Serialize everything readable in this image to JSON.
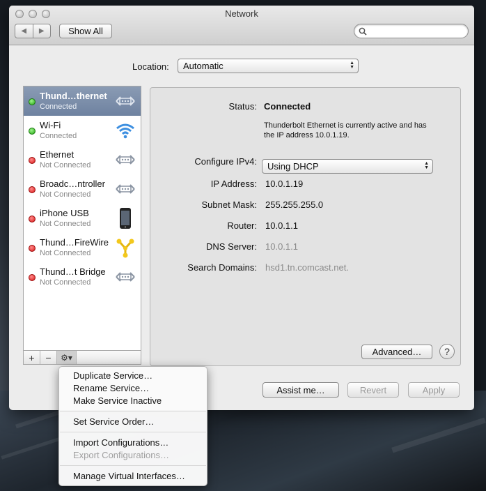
{
  "window": {
    "title": "Network"
  },
  "toolbar": {
    "back_icon": "chevron-left-icon",
    "forward_icon": "chevron-right-icon",
    "show_all_label": "Show All",
    "search_placeholder": ""
  },
  "location": {
    "label": "Location:",
    "value": "Automatic"
  },
  "services": [
    {
      "name": "Thund…thernet",
      "status": "Connected",
      "state": "green",
      "icon": "ethernet-icon",
      "selected": true
    },
    {
      "name": "Wi-Fi",
      "status": "Connected",
      "state": "green",
      "icon": "wifi-icon"
    },
    {
      "name": "Ethernet",
      "status": "Not Connected",
      "state": "red",
      "icon": "ethernet-icon"
    },
    {
      "name": "Broadc…ntroller",
      "status": "Not Connected",
      "state": "red",
      "icon": "ethernet-icon"
    },
    {
      "name": "iPhone USB",
      "status": "Not Connected",
      "state": "red",
      "icon": "iphone-icon"
    },
    {
      "name": "Thund…FireWire",
      "status": "Not Connected",
      "state": "red",
      "icon": "firewire-icon"
    },
    {
      "name": "Thund…t Bridge",
      "status": "Not Connected",
      "state": "red",
      "icon": "ethernet-icon"
    }
  ],
  "sidebar_tools": {
    "add": "+",
    "remove": "−",
    "gear": "⚙▾"
  },
  "detail": {
    "status_label": "Status:",
    "status_value": "Connected",
    "status_desc": "Thunderbolt Ethernet is currently active and has the IP address 10.0.1.19.",
    "configure_label": "Configure IPv4:",
    "configure_value": "Using DHCP",
    "ip_label": "IP Address:",
    "ip_value": "10.0.1.19",
    "subnet_label": "Subnet Mask:",
    "subnet_value": "255.255.255.0",
    "router_label": "Router:",
    "router_value": "10.0.1.1",
    "dns_label": "DNS Server:",
    "dns_value": "10.0.1.1",
    "search_label": "Search Domains:",
    "search_value": "hsd1.tn.comcast.net.",
    "advanced_label": "Advanced…",
    "help_label": "?"
  },
  "footer": {
    "assist_label": "Assist me…",
    "revert_label": "Revert",
    "apply_label": "Apply"
  },
  "menu": {
    "items": [
      "Duplicate Service…",
      "Rename Service…",
      "Make Service Inactive",
      "Set Service Order…",
      "Import Configurations…",
      "Export Configurations…",
      "Manage Virtual Interfaces…"
    ]
  },
  "colors": {
    "connected": "#23a512",
    "not_connected": "#d91515",
    "selection": "#7589a6"
  }
}
